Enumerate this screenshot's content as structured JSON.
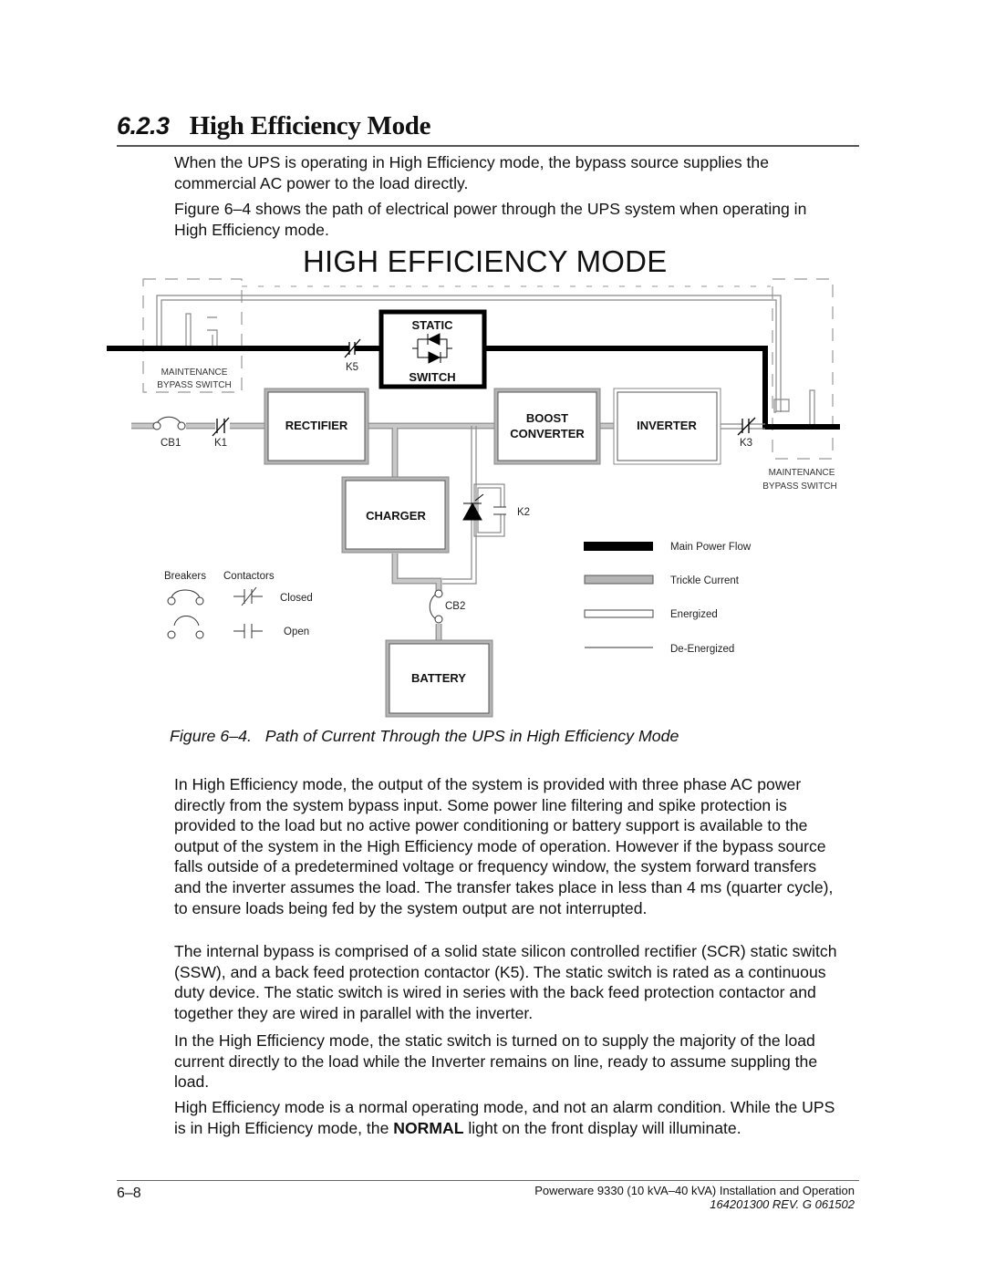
{
  "section": {
    "number": "6.2.3",
    "title": "High Efficiency Mode"
  },
  "intro_paragraphs": [
    "When the UPS is operating in High Efficiency mode, the bypass source supplies the commercial AC power to the load directly.",
    "Figure 6–4 shows the path of electrical power through the UPS system when operating in High Efficiency mode."
  ],
  "diagram": {
    "title": "HIGH EFFICIENCY MODE",
    "blocks": {
      "static_switch_top": "STATIC",
      "static_switch_bottom": "SWITCH",
      "rectifier": "RECTIFIER",
      "boost_line1": "BOOST",
      "boost_line2": "CONVERTER",
      "inverter": "INVERTER",
      "charger": "CHARGER",
      "battery": "BATTERY"
    },
    "labels": {
      "k5": "K5",
      "k1": "K1",
      "cb1": "CB1",
      "k3": "K3",
      "k2": "K2",
      "cb2": "CB2",
      "mbs_left_line1": "MAINTENANCE",
      "mbs_left_line2": "BYPASS SWITCH",
      "mbs_right_line1": "MAINTENANCE",
      "mbs_right_line2": "BYPASS SWITCH"
    },
    "symbol_legend": {
      "breakers": "Breakers",
      "contactors": "Contactors",
      "closed": "Closed",
      "open": "Open"
    },
    "line_legend": [
      {
        "style": "main",
        "label": "Main Power Flow",
        "color": "#000000"
      },
      {
        "style": "trickle",
        "label": "Trickle Current",
        "color": "#b4b4b4"
      },
      {
        "style": "energized",
        "label": "Energized",
        "color": "#ffffff"
      },
      {
        "style": "deenergized",
        "label": "De-Energized",
        "color": "#333333"
      }
    ]
  },
  "caption": {
    "label": "Figure 6–4.",
    "text": "Path of Current Through the UPS in High Efficiency Mode"
  },
  "body_paragraphs": [
    "In High Efficiency mode, the output of the system is provided with three phase AC power directly from the system bypass input.  Some power line filtering and spike protection is provided to the load but no active power conditioning or battery support is available to the output of the system in the High Efficiency mode of operation.  However if the bypass source falls outside of a predetermined voltage or frequency window, the system forward transfers and the inverter assumes the load. The transfer takes place in less than 4 ms (quarter cycle), to ensure loads being fed by the system output are not interrupted.",
    "The internal bypass is comprised of a solid state silicon controlled rectifier (SCR) static switch (SSW), and a back feed protection contactor (K5).  The static switch is rated as a continuous duty device.  The static switch is wired in series with the back feed protection contactor and together they are wired in parallel with the inverter.",
    "In the High Efficiency mode, the static switch is turned on to supply the majority of the load current directly to the load while the Inverter remains on line, ready to assume suppling the load."
  ],
  "last_paragraph": {
    "before": "High Efficiency mode is a normal operating mode, and not an alarm condition. While the UPS is in High Efficiency mode, the ",
    "bold": "NORMAL",
    "after": " light on the front display will illuminate."
  },
  "footer": {
    "page": "6–8",
    "manual": "Powerware 9330 (10 kVA–40 kVA) Installation and Operation",
    "revision": "164201300 REV. G  061502"
  }
}
